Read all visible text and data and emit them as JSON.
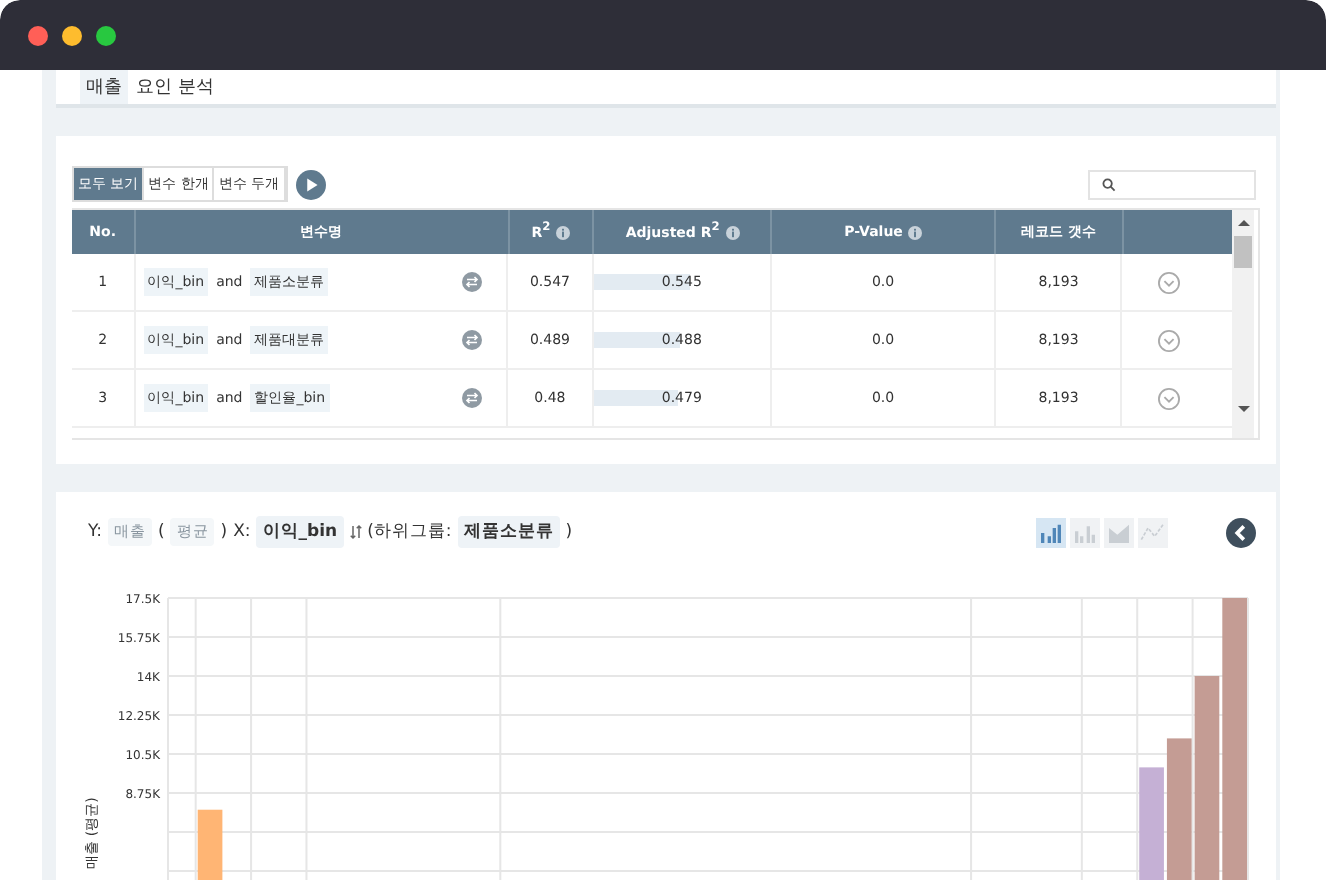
{
  "window": {
    "controls": [
      {
        "color": "#ff5f57"
      },
      {
        "color": "#febc2e"
      },
      {
        "color": "#28c840"
      }
    ]
  },
  "header": {
    "tag": "매출",
    "title": "요인 분석"
  },
  "filters": [
    {
      "label": "모두 보기",
      "selected": true
    },
    {
      "label": "변수 한개",
      "selected": false
    },
    {
      "label": "변수 두개",
      "selected": false
    }
  ],
  "table": {
    "columns": [
      {
        "label": "No.",
        "info": false
      },
      {
        "label": "변수명",
        "info": false
      },
      {
        "label": "R$^{2}$",
        "info": true
      },
      {
        "label": "Adjusted R$^{2}$",
        "info": true
      },
      {
        "label": "P-Value",
        "info": true
      },
      {
        "label": "레코드 갯수",
        "info": false
      }
    ],
    "rows": [
      {
        "no": "1",
        "var_a": "이익_bin",
        "joiner": "and",
        "var_b": "제품소분류",
        "r2": "0.547",
        "adjusted_r2": "0.545",
        "level": 0.545,
        "p_value": "0.0",
        "records": "8,193"
      },
      {
        "no": "2",
        "var_a": "이익_bin",
        "joiner": "and",
        "var_b": "제품대분류",
        "r2": "0.489",
        "adjusted_r2": "0.488",
        "level": 0.488,
        "p_value": "0.0",
        "records": "8,193"
      },
      {
        "no": "3",
        "var_a": "이익_bin",
        "joiner": "and",
        "var_b": "할인율_bin",
        "r2": "0.48",
        "adjusted_r2": "0.479",
        "level": 0.479,
        "p_value": "0.0",
        "records": "8,193"
      }
    ]
  },
  "chart_header": {
    "y_label": "Y:",
    "y_value": "매출",
    "open_paren": "(",
    "aggregate": "평균",
    "close_paren": ")",
    "x_label": "X:",
    "x_value": "이익_bin",
    "subgroup_label": "(하위그룹:",
    "subgroup_value": "제품소분류",
    "subgroup_close": ")"
  },
  "chart_types": [
    {
      "kind": "bar",
      "selected": true
    },
    {
      "kind": "grouped",
      "selected": false
    },
    {
      "kind": "area",
      "selected": false
    },
    {
      "kind": "line",
      "selected": false
    }
  ],
  "chart": {
    "chart_data": {
      "type": "bar",
      "grid": true,
      "ylabel": "매출 (평균)",
      "categories": [
        null,
        null,
        null,
        null,
        null,
        null,
        null,
        null,
        null,
        null,
        null,
        null,
        null,
        null,
        null,
        null,
        null,
        null,
        null,
        null,
        null,
        null,
        null,
        null,
        null,
        null,
        null,
        null,
        null,
        null,
        null,
        null,
        null,
        null,
        null,
        null,
        null,
        null,
        null
      ],
      "ylim": [
        0,
        17500
      ],
      "yticks": [
        {
          "value": 8750,
          "label": "8.75K"
        },
        {
          "value": 10500,
          "label": "10.5K"
        },
        {
          "value": 12250,
          "label": "12.25K"
        },
        {
          "value": 14000,
          "label": "14K"
        },
        {
          "value": 15750,
          "label": "15.75K"
        },
        {
          "value": 17500,
          "label": "17.5K"
        }
      ],
      "series": [
        {
          "color": "#ffb574",
          "values": [
            null,
            8000,
            null,
            null,
            null,
            null,
            null,
            null,
            null,
            null,
            null,
            null,
            null,
            null,
            null,
            null,
            null,
            null,
            null,
            null,
            null,
            null,
            null,
            null,
            null,
            null,
            null,
            null,
            null,
            null,
            null,
            null,
            null,
            null,
            null,
            null,
            null,
            null,
            null
          ]
        },
        {
          "color": "#c5b0d5",
          "values": [
            null,
            null,
            null,
            null,
            null,
            null,
            null,
            null,
            null,
            null,
            null,
            null,
            null,
            null,
            null,
            null,
            null,
            null,
            null,
            null,
            null,
            null,
            null,
            null,
            null,
            null,
            null,
            null,
            null,
            null,
            null,
            null,
            null,
            null,
            null,
            9900,
            null,
            null,
            null
          ]
        },
        {
          "color": "#c49c94",
          "values": [
            null,
            null,
            null,
            null,
            null,
            null,
            null,
            null,
            null,
            null,
            null,
            null,
            null,
            null,
            null,
            null,
            null,
            null,
            null,
            null,
            null,
            null,
            null,
            null,
            null,
            null,
            null,
            null,
            null,
            null,
            null,
            null,
            null,
            null,
            null,
            null,
            11200,
            14000,
            17500
          ]
        }
      ]
    }
  }
}
